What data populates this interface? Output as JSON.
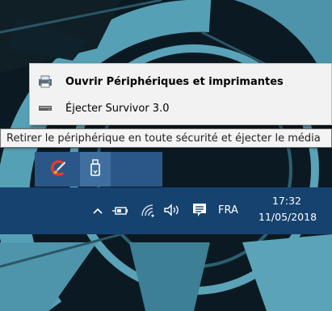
{
  "context_menu": {
    "items": [
      {
        "label": "Ouvrir Périphériques et imprimantes",
        "icon": "printer-icon"
      },
      {
        "label": "Éjecter Survivor 3.0",
        "icon": "drive-icon"
      }
    ]
  },
  "tooltip": {
    "text": "Retirer le périphérique en toute sécurité et éjecter le média"
  },
  "overflow_tray": {
    "icons": [
      "ccleaner-icon",
      "usb-drive-icon"
    ]
  },
  "taskbar": {
    "chevron": "^",
    "language": "FRA",
    "time": "17:32",
    "date": "11/05/2018",
    "icons": [
      "chevron-up-icon",
      "power-icon",
      "wifi-icon",
      "volume-icon",
      "notification-icon"
    ]
  },
  "colors": {
    "taskbar_bg": "#16426f",
    "tray_bg": "#2a5787",
    "menu_bg": "#f2f2f2",
    "wallpaper_accent": "#5aa3b8"
  }
}
